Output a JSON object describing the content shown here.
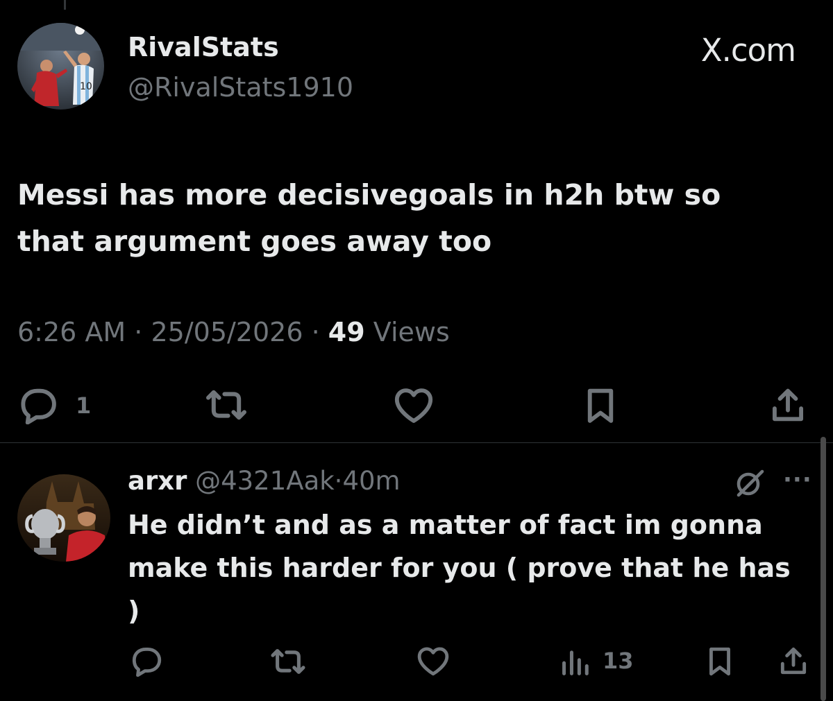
{
  "tweet": {
    "display_name": "RivalStats",
    "handle": "@RivalStats1910",
    "brand": "X.com",
    "text": "Messi has more decisivegoals in h2h btw so that argument goes away too",
    "time": "6:26 AM",
    "date": "25/05/2026",
    "separator": "·",
    "views_count": "49",
    "views_label": "Views",
    "actions": {
      "reply_count": "1"
    }
  },
  "reply": {
    "display_name": "arxr",
    "handle": "@4321Aak",
    "separator": "·",
    "time": "40m",
    "text": "He didn’t and as a matter of fact im gonna make this harder for you ( prove that he has )",
    "more": "···",
    "actions": {
      "views_count": "13"
    }
  },
  "icons": [
    "reply-icon",
    "retweet-icon",
    "like-icon",
    "bookmark-icon",
    "share-icon",
    "views-icon",
    "grok-icon",
    "more-icon"
  ],
  "colors": {
    "background": "#000000",
    "text": "#e7e9ea",
    "secondary": "#71767b",
    "divider": "#2f3336"
  }
}
